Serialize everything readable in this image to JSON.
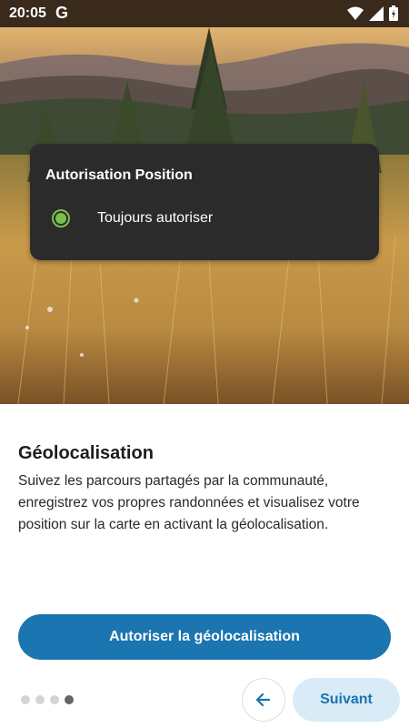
{
  "status_bar": {
    "time": "20:05",
    "google_glyph": "G",
    "icons": [
      "wifi-icon",
      "signal-icon",
      "battery-icon"
    ]
  },
  "permission": {
    "title": "Autorisation Position",
    "option_label": "Toujours autoriser",
    "option_selected": true
  },
  "content": {
    "title": "Géolocalisation",
    "description": "Suivez les parcours partagés par la communauté, enregistrez vos propres randonnées et visualisez votre position sur la carte en activant la géolocalisation."
  },
  "actions": {
    "primary_label": "Autoriser la géolocalisation",
    "next_label": "Suivant",
    "back_icon": "arrow-left-icon"
  },
  "pager": {
    "count": 4,
    "active_index": 3
  },
  "colors": {
    "primary": "#1a75b0",
    "next_bg": "#d8ebf7",
    "radio_accent": "#7cc04a",
    "card_bg": "#2b2b2b"
  }
}
